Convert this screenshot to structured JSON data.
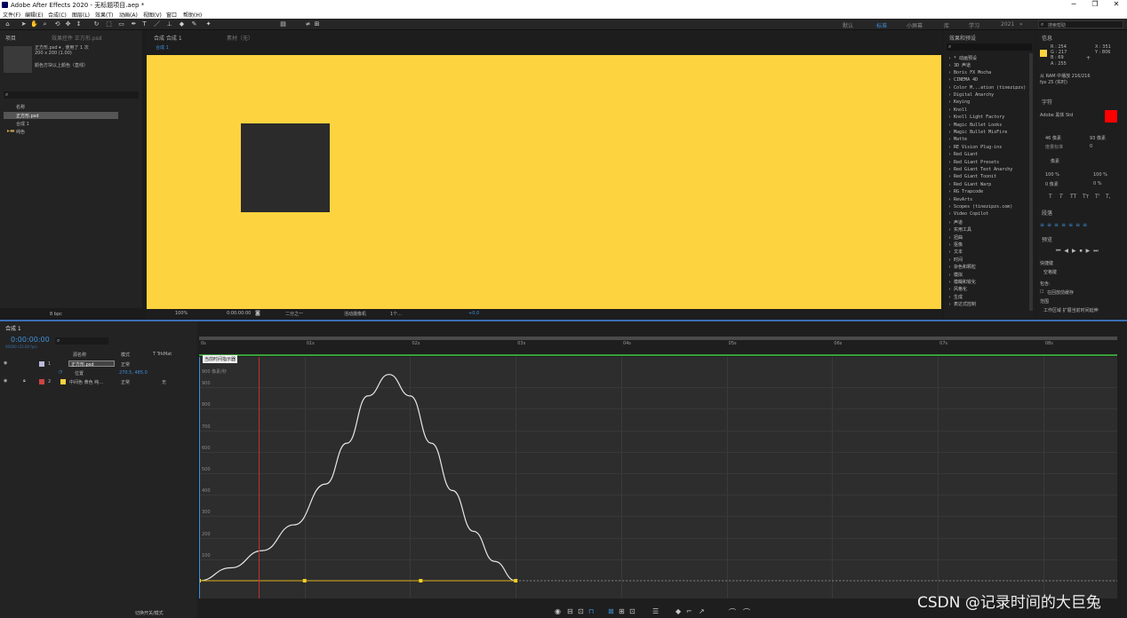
{
  "window": {
    "title": "Adobe After Effects 2020 - 无标题项目.aep *",
    "minimize": "─",
    "maximize": "❐",
    "close": "✕"
  },
  "menu": [
    "文件(F)",
    "编辑(E)",
    "合成(C)",
    "图层(L)",
    "效果(T)",
    "动画(A)",
    "视图(V)",
    "窗口",
    "帮助(H)"
  ],
  "workspaces": {
    "items": [
      "默认",
      "标准",
      "小屏幕",
      "库",
      "学习",
      "2021"
    ],
    "active_index": 1,
    "search_placeholder": "搜索帮助"
  },
  "project": {
    "tab": "项目",
    "effect_controls_tab": "效果控件 正方形.psd",
    "selected_name": "正方形.psd ▾ , 使用了 1 次",
    "selected_size": "200 x 200 (1.00)",
    "selected_desc": "颜色方块以上颜色（直线）",
    "col_name": "名称",
    "items": [
      {
        "name": "正方形.psd",
        "type": "psd"
      },
      {
        "name": "合成 1",
        "type": "comp"
      },
      {
        "name": "纯色",
        "type": "folder"
      }
    ],
    "bpc": "8 bpc"
  },
  "composition": {
    "tab": "合成 合成 1",
    "footage_tab": "素材（无）",
    "sub_tab": "合成 1",
    "zoom": "100%",
    "timecode": "0:00:00:00",
    "resolution": "二分之一",
    "camera": "活动摄像机",
    "views": "1个...",
    "exposure": "+0.0"
  },
  "effects_presets": {
    "title": "效果和预设",
    "items": [
      "* 动画预设",
      "3D 声道",
      "Boris FX Mocha",
      "CINEMA 4D",
      "Color M...ation (tinezipzs)",
      "Digital Anarchy",
      "Keying",
      "Knoll",
      "Knoll Light Factory",
      "Magic Bullet Looks",
      "Magic Bullet MisFire",
      "Matte",
      "RE Vision Plug-ins",
      "Red Giant",
      "Red Giant Presets",
      "Red Giant Text Anarchy",
      "Red Giant Toonit",
      "Red Giant Warp",
      "RG Trapcode",
      "RevArts",
      "Scopes (tinezipzs.com)",
      "Video Copilot",
      "声道",
      "实用工具",
      "扭曲",
      "抠像",
      "文本",
      "时间",
      "杂色和颗粒",
      "模拟",
      "模糊和锐化",
      "风格化",
      "生成",
      "表达式控制"
    ]
  },
  "info_panel": {
    "title": "信息",
    "r": "R : 254",
    "g": "G : 217",
    "b": "B : 69",
    "a": "A : 255",
    "x": "X : 351",
    "y": "Y : 806",
    "from": "从 RAM 中播放 216/216",
    "fps": "fps 25 (实时)",
    "swatch": "#fdd33f"
  },
  "character_panel": {
    "title": "字符",
    "font": "Adobe 黑体 Std",
    "size": "46 像素",
    "leading": "93 像素",
    "kerning": "度量标准",
    "tracking": "0",
    "unit": "像素",
    "vscale": "100 %",
    "hscale": "100 %",
    "baseline": "0 像素",
    "tsume": "0 %",
    "styles": [
      "T",
      "T",
      "TT",
      "Tт",
      "T'",
      "T,"
    ],
    "fill_color": "#ff0000"
  },
  "paragraph_panel": {
    "title": "段落"
  },
  "preview_panel": {
    "title": "预览",
    "shortcut_label": "快捷键",
    "shortcut_value": "空格键",
    "include_label": "包含:",
    "cache_label": "在回放前缓存",
    "range_label": "范围",
    "range_value": "工作区域 扩展当前时间延伸"
  },
  "timeline": {
    "tab": "合成 1",
    "timecode": "0:00:00:00",
    "timecode_sub": "00000 (25.00 fps)",
    "columns": {
      "name": "源名称",
      "mode": "模式",
      "trkmat": "T TrkMat"
    },
    "layers": [
      {
        "index": "1",
        "name": "正方形.psd",
        "mode": "正常",
        "trkmat": "",
        "color": "#b9b9e0"
      },
      {
        "index": "2",
        "name": "中间色 黄色 纯...",
        "mode": "正常",
        "trkmat": "无",
        "color": "#cc4444"
      }
    ],
    "property": {
      "name": "位置",
      "value": "270.5, 485.0"
    },
    "tooltip": "当前时间指示器",
    "ruler_labels": [
      "0s",
      "01s",
      "02s",
      "03s",
      "04s",
      "05s",
      "06s",
      "07s",
      "08s"
    ],
    "switches_label": "切换开关/模式"
  },
  "graph": {
    "unit_label": "900 像素/秒",
    "y_labels": [
      "900",
      "800",
      "700",
      "600",
      "500",
      "400",
      "300",
      "200",
      "100"
    ]
  },
  "chart_data": {
    "type": "line",
    "title": "",
    "xlabel": "",
    "ylabel": "像素/秒",
    "xlim": [
      0,
      8.7
    ],
    "ylim": [
      0,
      1000
    ],
    "series": [
      {
        "values_note": "",
        "x": [
          0,
          0.3,
          0.6,
          0.9,
          1.2,
          1.4,
          1.6,
          1.8,
          2.0,
          2.2,
          2.4,
          2.6,
          2.8,
          3.0
        ],
        "y": [
          0,
          60,
          140,
          260,
          450,
          640,
          860,
          960,
          860,
          640,
          420,
          230,
          90,
          0
        ]
      }
    ],
    "keyframes_x": [
      0,
      1.0,
      2.1,
      3.0
    ]
  },
  "watermark": "CSDN @记录时间的大巨兔"
}
